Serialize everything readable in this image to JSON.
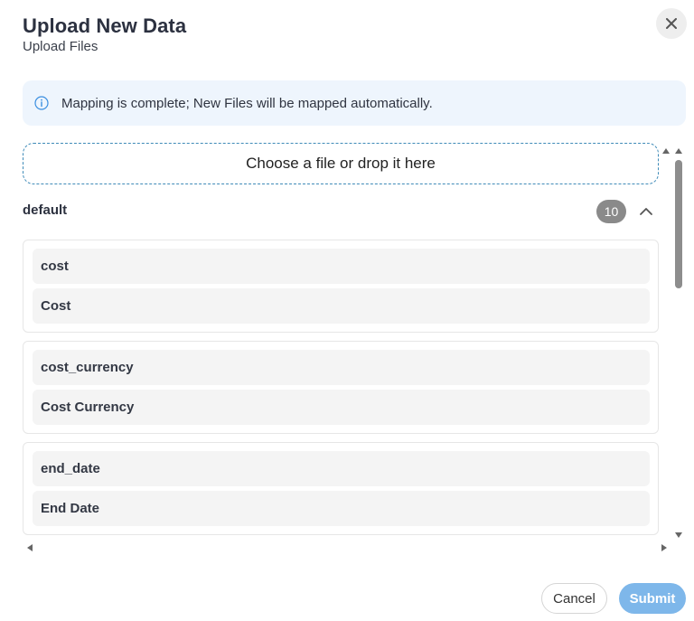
{
  "dialog": {
    "title": "Upload New Data",
    "subtitle": "Upload Files",
    "close_icon": "close-icon"
  },
  "banner": {
    "icon": "info-icon",
    "text": "Mapping is complete; New Files will be mapped automatically."
  },
  "dropzone": {
    "label": "Choose a file or drop it here"
  },
  "group": {
    "name": "default",
    "count": "10",
    "toggle_icon": "chevron-up-icon"
  },
  "fields": [
    {
      "key": "cost",
      "label": "Cost"
    },
    {
      "key": "cost_currency",
      "label": "Cost Currency"
    },
    {
      "key": "end_date",
      "label": "End Date"
    }
  ],
  "footer": {
    "cancel_label": "Cancel",
    "submit_label": "Submit"
  },
  "colors": {
    "banner_bg": "#eef5fd",
    "accent": "#7eb7ea",
    "dropzone_border": "#3f8bb8",
    "badge_bg": "#8a8a8a"
  }
}
